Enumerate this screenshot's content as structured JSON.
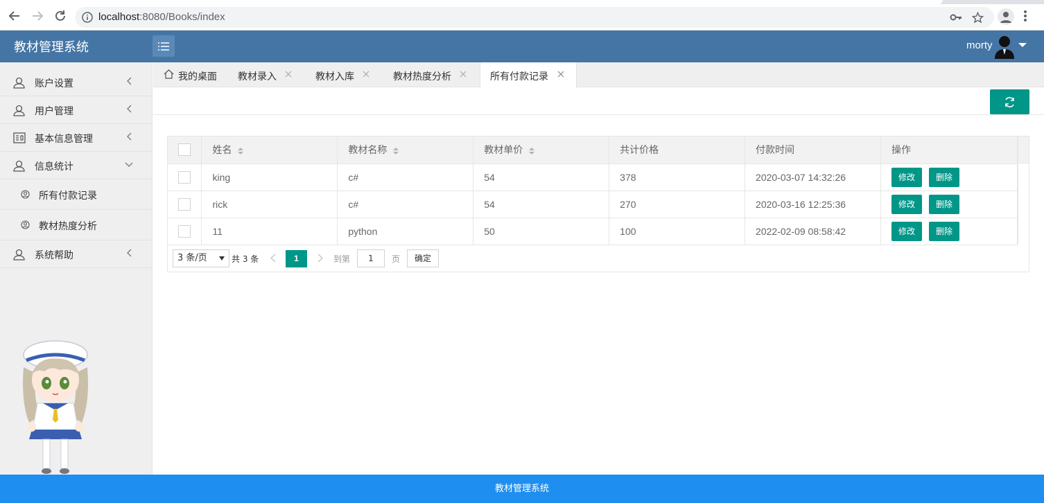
{
  "browser": {
    "url_prefix": "localhost",
    "url_rest": ":8080/Books/index"
  },
  "header": {
    "title": "教材管理系统",
    "user": "morty"
  },
  "sidebar": {
    "items": [
      {
        "label": "账户设置",
        "icon": "user-icon"
      },
      {
        "label": "用户管理",
        "icon": "user-icon"
      },
      {
        "label": "基本信息管理",
        "icon": "id-card-icon"
      },
      {
        "label": "信息统计",
        "icon": "user-icon",
        "expanded": true
      },
      {
        "label": "系统帮助",
        "icon": "user-icon"
      }
    ],
    "sub_items": [
      {
        "label": "所有付款记录"
      },
      {
        "label": "教材热度分析"
      }
    ]
  },
  "tabs": [
    {
      "label": "我的桌面"
    },
    {
      "label": "教材录入"
    },
    {
      "label": "教材入库"
    },
    {
      "label": "教材热度分析"
    },
    {
      "label": "所有付款记录",
      "active": true
    }
  ],
  "table": {
    "headers": [
      "姓名",
      "教材名称",
      "教材单价",
      "共计价格",
      "付款时间",
      "操作"
    ],
    "rows": [
      {
        "name": "king",
        "book": "c#",
        "price": "54",
        "total": "378",
        "time": "2020-03-07 14:32:26"
      },
      {
        "name": "rick",
        "book": "c#",
        "price": "54",
        "total": "270",
        "time": "2020-03-16 12:25:36"
      },
      {
        "name": "11",
        "book": "python",
        "price": "50",
        "total": "100",
        "time": "2022-02-09 08:58:42"
      }
    ],
    "edit_label": "修改",
    "delete_label": "删除"
  },
  "pager": {
    "page_size": "3 条/页",
    "total": "共 3 条",
    "current": "1",
    "goto_label": "到第",
    "goto_value": "1",
    "page_unit": "页",
    "confirm": "确定"
  },
  "footer": {
    "text": "教材管理系统"
  },
  "colors": {
    "header": "#4475a4",
    "accent": "#009688",
    "footer": "#1e8ff0"
  }
}
